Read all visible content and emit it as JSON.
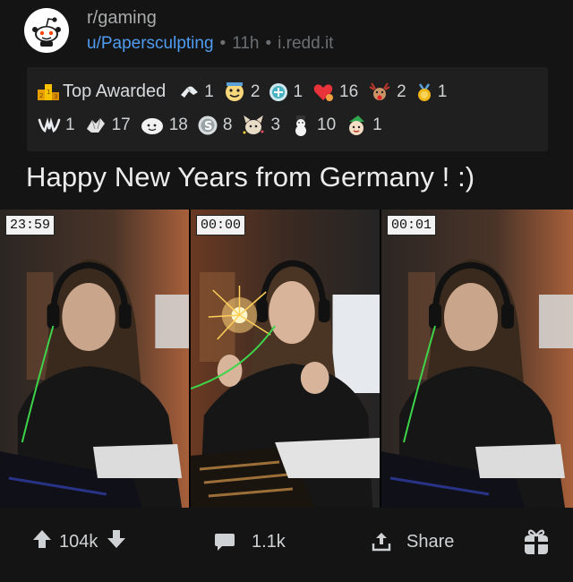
{
  "post": {
    "subreddit": "r/gaming",
    "author": "u/Papersculpting",
    "separator": "•",
    "age": "11h",
    "domain": "i.redd.it",
    "title": "Happy New Years from Germany ! :)"
  },
  "awards": {
    "label": "Top Awarded",
    "row1": [
      {
        "icon": "helping-hand-icon",
        "count": "1"
      },
      {
        "icon": "wholesome-award-icon",
        "count": "2"
      },
      {
        "icon": "platinum-award-icon",
        "count": "1"
      },
      {
        "icon": "heartwarming-award-icon",
        "count": "16"
      },
      {
        "icon": "rudolph-award-icon",
        "count": "2"
      },
      {
        "icon": "gold-award-icon",
        "count": "1"
      }
    ],
    "row2": [
      {
        "icon": "bless-up-award-icon",
        "count": "1"
      },
      {
        "icon": "wholesome-hands-award-icon",
        "count": "17"
      },
      {
        "icon": "hugz-award-icon",
        "count": "18"
      },
      {
        "icon": "silver-award-icon",
        "count": "8"
      },
      {
        "icon": "party-cat-award-icon",
        "count": "3"
      },
      {
        "icon": "snowman-award-icon",
        "count": "10"
      },
      {
        "icon": "elf-award-icon",
        "count": "1"
      }
    ]
  },
  "media": {
    "frames": [
      {
        "timestamp": "23:59"
      },
      {
        "timestamp": "00:00"
      },
      {
        "timestamp": "00:01"
      }
    ]
  },
  "actions": {
    "upvotes": "104k",
    "comments": "1.1k",
    "share": "Share"
  },
  "colors": {
    "background": "#141414",
    "award_panel": "#1f1f1f",
    "link_blue": "#4f9cf0",
    "muted_text": "#6b6f72"
  }
}
